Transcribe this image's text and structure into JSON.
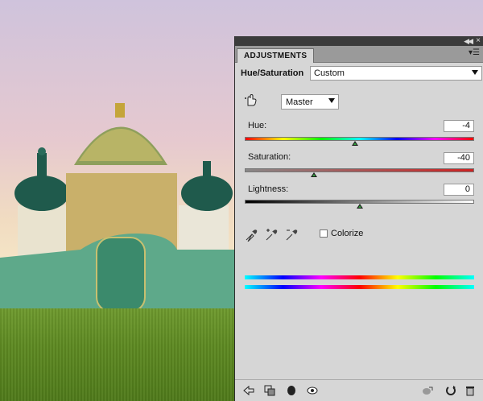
{
  "panel": {
    "tab_label": "ADJUSTMENTS",
    "adjustment_title": "Hue/Saturation",
    "preset_value": "Custom",
    "channel_value": "Master",
    "hue": {
      "label": "Hue:",
      "value": "-4",
      "fraction": 0.48
    },
    "saturation": {
      "label": "Saturation:",
      "value": "-40",
      "fraction": 0.3
    },
    "lightness": {
      "label": "Lightness:",
      "value": "0",
      "fraction": 0.5
    },
    "colorize_label": "Colorize",
    "colorize_checked": false
  },
  "icons": {
    "collapse": "double-chevron-icon",
    "close": "close-icon",
    "panel_menu": "panel-menu-icon",
    "targeted_adjust": "hand-target-icon",
    "eyedropper": "eyedropper-icon",
    "eyedropper_add": "eyedropper-plus-icon",
    "eyedropper_subtract": "eyedropper-minus-icon",
    "footer": [
      "back-arrow-icon",
      "clip-to-layer-icon",
      "mask-icon",
      "visibility-eye-icon",
      "previous-state-icon",
      "reset-icon",
      "trash-icon"
    ]
  }
}
